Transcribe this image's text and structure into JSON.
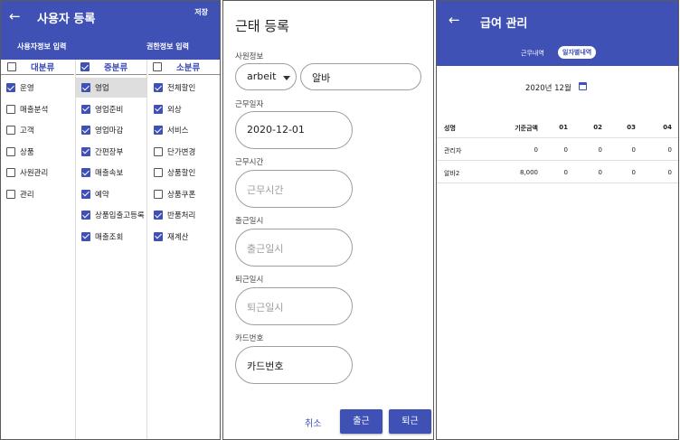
{
  "screen1": {
    "back_glyph": "←",
    "title": "사용자 등록",
    "save_label": "저장",
    "tabs": [
      "사용자정보 입력",
      "권한정보 입력"
    ],
    "columns": [
      {
        "header": "대분류",
        "header_checked": false,
        "items": [
          {
            "label": "운영",
            "checked": true,
            "selected": false
          },
          {
            "label": "매출분석",
            "checked": false,
            "selected": false
          },
          {
            "label": "고객",
            "checked": false,
            "selected": false
          },
          {
            "label": "상품",
            "checked": false,
            "selected": false
          },
          {
            "label": "사원관리",
            "checked": false,
            "selected": false
          },
          {
            "label": "관리",
            "checked": false,
            "selected": false
          }
        ]
      },
      {
        "header": "중분류",
        "header_checked": true,
        "items": [
          {
            "label": "영업",
            "checked": true,
            "selected": true
          },
          {
            "label": "영업준비",
            "checked": true,
            "selected": false
          },
          {
            "label": "영업마감",
            "checked": true,
            "selected": false
          },
          {
            "label": "간편장부",
            "checked": true,
            "selected": false
          },
          {
            "label": "매출속보",
            "checked": true,
            "selected": false
          },
          {
            "label": "예약",
            "checked": true,
            "selected": false
          },
          {
            "label": "상품입출고등록",
            "checked": true,
            "selected": false
          },
          {
            "label": "매출조회",
            "checked": true,
            "selected": false
          }
        ]
      },
      {
        "header": "소분류",
        "header_checked": false,
        "items": [
          {
            "label": "전체할인",
            "checked": true,
            "selected": false
          },
          {
            "label": "외상",
            "checked": true,
            "selected": false
          },
          {
            "label": "서비스",
            "checked": true,
            "selected": false
          },
          {
            "label": "단가변경",
            "checked": false,
            "selected": false
          },
          {
            "label": "상품할인",
            "checked": false,
            "selected": false
          },
          {
            "label": "상품쿠폰",
            "checked": false,
            "selected": false
          },
          {
            "label": "반품처리",
            "checked": true,
            "selected": false
          },
          {
            "label": "재계산",
            "checked": true,
            "selected": false
          }
        ]
      }
    ]
  },
  "screen2": {
    "title": "근태 등록",
    "employee_label": "사원정보",
    "employee_type": "arbeit",
    "employee_name": "알바",
    "work_date_label": "근무일자",
    "work_date": "2020-12-01",
    "work_time_label": "근무시간",
    "work_time_placeholder": "근무시간",
    "check_in_label": "출근일시",
    "check_in_placeholder": "출근일시",
    "check_out_label": "퇴근일시",
    "check_out_placeholder": "퇴근일시",
    "card_label": "카드번호",
    "card_value": "카드번호",
    "cancel_label": "취소",
    "check_in_button": "출근",
    "check_out_button": "퇴근"
  },
  "screen3": {
    "back_glyph": "←",
    "title": "급여 관리",
    "tabs": [
      "근무내역",
      "일자별내역"
    ],
    "active_tab": 1,
    "month": "2020년 12월",
    "table": {
      "headers": [
        "성명",
        "기준금액",
        "01",
        "02",
        "03",
        "04"
      ],
      "rows": [
        [
          "관리자",
          "0",
          "0",
          "0",
          "0",
          "0"
        ],
        [
          "알바2",
          "8,000",
          "0",
          "0",
          "0",
          "0"
        ]
      ]
    }
  },
  "colors": {
    "primary": "#3f51b5",
    "selected_row": "#dedede"
  }
}
